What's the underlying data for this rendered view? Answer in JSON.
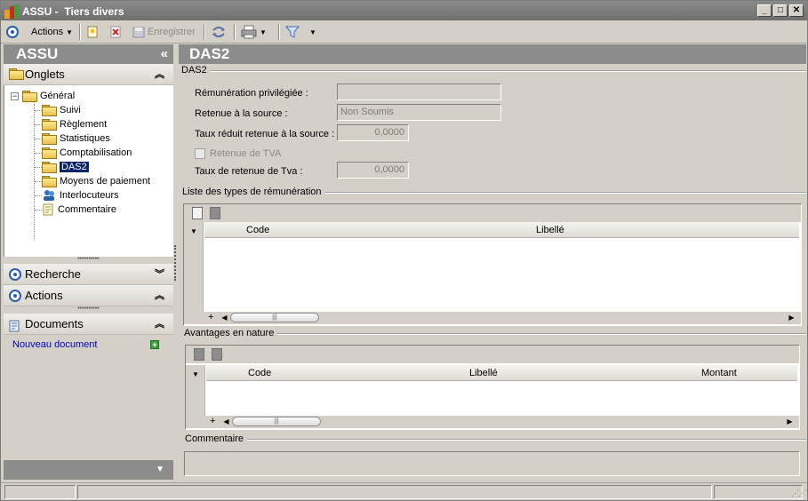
{
  "window": {
    "title": "ASSU -  Tiers divers",
    "minimize": "_",
    "maximize": "□",
    "close": "✕"
  },
  "toolbar": {
    "actions_label": "Actions",
    "save_label": "Enregistrer"
  },
  "left_panel": {
    "header": "ASSU",
    "collapse_glyph": "«",
    "onglets_label": "Onglets",
    "tree_root": "Général",
    "tree_items": [
      "Suivi",
      "Règlement",
      "Statistiques",
      "Comptabilisation",
      "DAS2",
      "Moyens de paiement",
      "Interlocuteurs",
      "Commentaire"
    ],
    "selected_item": "DAS2",
    "recherche_label": "Recherche",
    "actions_label": "Actions",
    "documents_label": "Documents",
    "new_document_link": "Nouveau document"
  },
  "main": {
    "header": "DAS2",
    "das2_group": "DAS2",
    "fields": {
      "remuneration_privilegiee_label": "Rémunération privilégiée :",
      "remuneration_privilegiee_value": "",
      "retenue_source_label": "Retenue à la source :",
      "retenue_source_value": "Non Soumis",
      "taux_reduit_label": "Taux réduit retenue à la source :",
      "taux_reduit_value": "0,0000",
      "retenue_tva_label": "Retenue de TVA",
      "retenue_tva_checked": false,
      "taux_tva_label": "Taux de retenue de Tva :",
      "taux_tva_value": "0,0000"
    },
    "remuneration_group": "Liste des types de rémunération",
    "remuneration_columns": [
      "Code",
      "Libellé"
    ],
    "avantages_group": "Avantages en nature",
    "avantages_columns": [
      "Code",
      "Libellé",
      "Montant"
    ],
    "commentaire_group": "Commentaire",
    "commentaire_value": ""
  },
  "colors": {
    "header_gray": "#8c8c8c",
    "selection_blue": "#0a246a",
    "link_blue": "#0000c0"
  }
}
